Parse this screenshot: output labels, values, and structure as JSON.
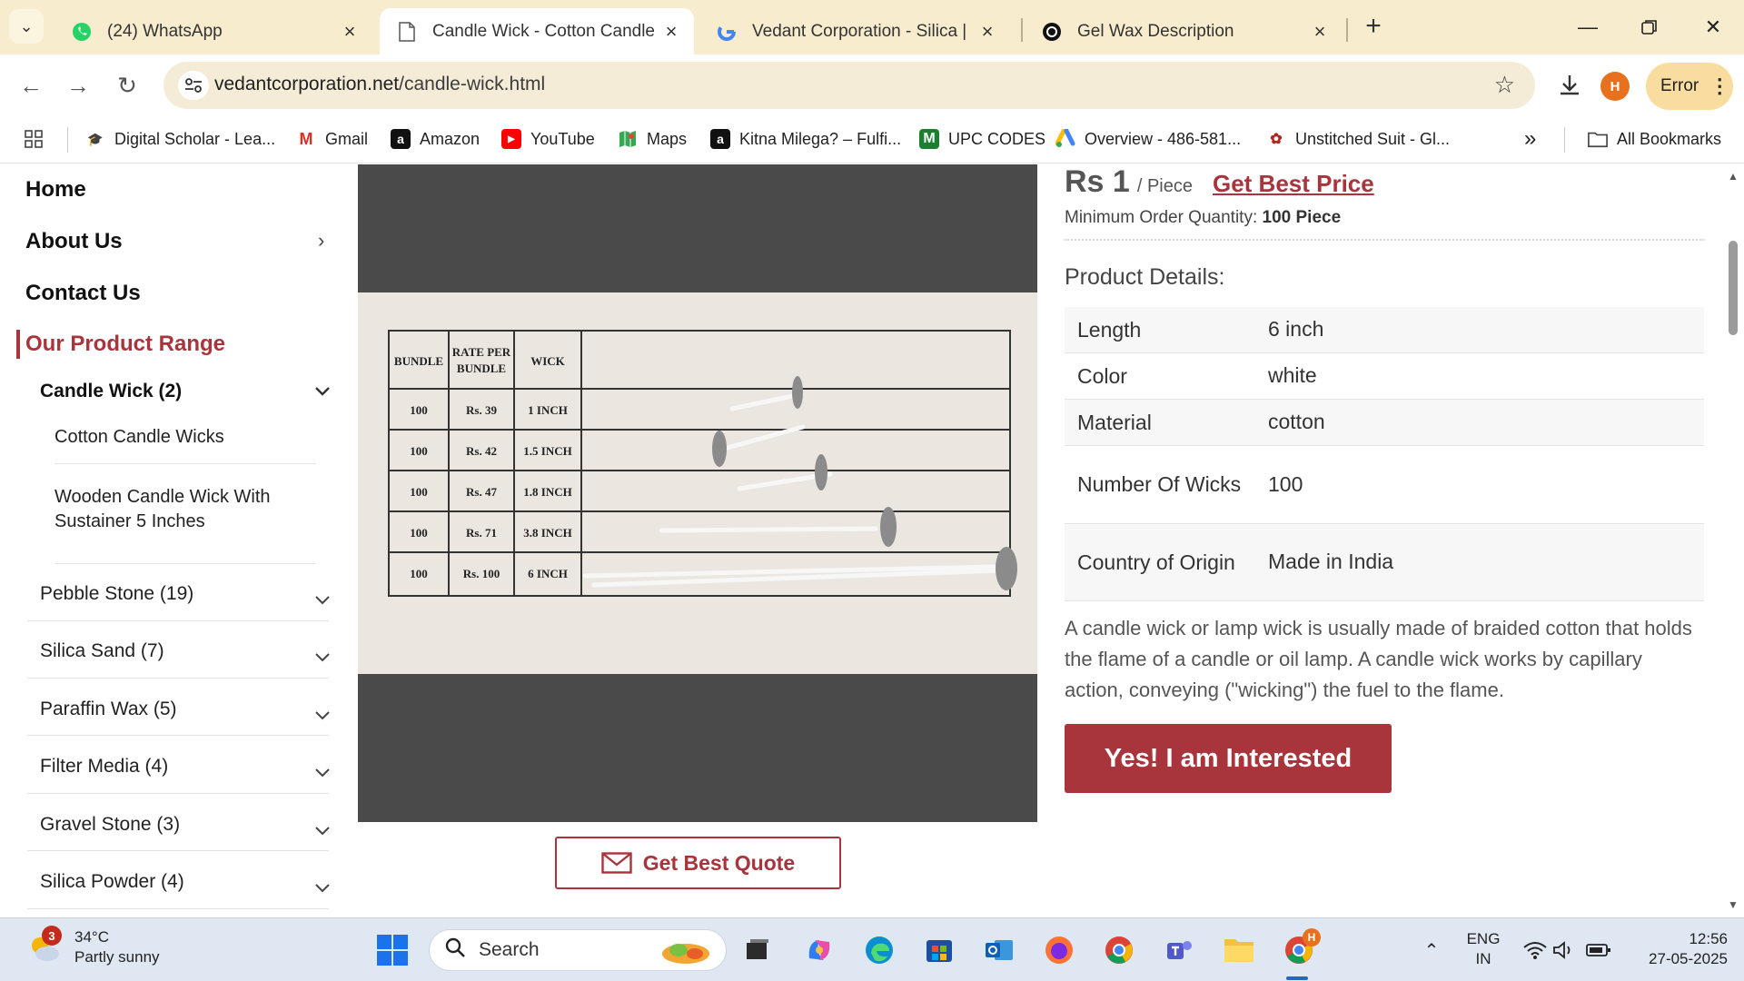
{
  "browser": {
    "tabs": [
      {
        "title": "(24) WhatsApp",
        "icon": "whatsapp-icon",
        "active": false
      },
      {
        "title": "Candle Wick - Cotton Candle W",
        "icon": "page-icon",
        "active": true
      },
      {
        "title": "Vedant Corporation - Silica | Qu",
        "icon": "google-icon",
        "active": false
      },
      {
        "title": "Gel Wax Description",
        "icon": "chatgpt-icon",
        "active": false
      }
    ],
    "url_host": "vedantcorporation.net",
    "url_path": "/candle-wick.html",
    "profile_initial": "H",
    "error_label": "Error",
    "bookmarks": [
      {
        "label": "Digital Scholar - Lea..."
      },
      {
        "label": "Gmail"
      },
      {
        "label": "Amazon"
      },
      {
        "label": "YouTube"
      },
      {
        "label": "Maps"
      },
      {
        "label": "Kitna Milega? – Fulfi..."
      },
      {
        "label": "UPC CODES"
      },
      {
        "label": "Overview - 486-581..."
      },
      {
        "label": "Unstitched Suit - Gl..."
      }
    ],
    "more_bookmarks": "»",
    "all_bookmarks": "All Bookmarks"
  },
  "sidebar": {
    "home": "Home",
    "about": "About Us",
    "contact": "Contact Us",
    "range_title": "Our Product Range",
    "active_category": "Candle Wick (2)",
    "sub_items": [
      "Cotton Candle Wicks",
      "Wooden Candle Wick With Sustainer 5 Inches"
    ],
    "categories": [
      "Pebble Stone (19)",
      "Silica Sand (7)",
      "Paraffin Wax (5)",
      "Filter Media (4)",
      "Gravel Stone (3)",
      "Silica Powder (4)"
    ]
  },
  "product": {
    "price": "Rs 1",
    "price_unit": "/ Piece",
    "best_price_label": "Get Best Price",
    "moq_label": "Minimum Order Quantity:",
    "moq_value": "100 Piece",
    "details_title": "Product Details:",
    "specs": [
      {
        "key": "Length",
        "value": "6 inch"
      },
      {
        "key": "Color",
        "value": "white"
      },
      {
        "key": "Material",
        "value": "cotton"
      },
      {
        "key": "Number Of Wicks",
        "value": "100"
      },
      {
        "key": "Country of Origin",
        "value": "Made in India"
      }
    ],
    "description": "A candle wick or lamp wick is usually made of braided cotton that holds the flame of a candle or oil lamp. A candle wick works by capillary action, conveying (\"wicking\") the fuel to the flame.",
    "interest_button": "Yes! I am Interested",
    "quote_button": "Get Best Quote",
    "photo_table": {
      "headers": [
        "BUNDLE",
        "RATE PER BUNDLE",
        "WICK"
      ],
      "rows": [
        [
          "100",
          "Rs. 39",
          "1 INCH"
        ],
        [
          "100",
          "Rs. 42",
          "1.5 INCH"
        ],
        [
          "100",
          "Rs. 47",
          "1.8 INCH"
        ],
        [
          "100",
          "Rs. 71",
          "3.8 INCH"
        ],
        [
          "100",
          "Rs. 100",
          "6 INCH"
        ]
      ]
    }
  },
  "taskbar": {
    "weather_badge": "3",
    "temperature": "34°C",
    "weather_text": "Partly sunny",
    "search_label": "Search",
    "lang_line1": "ENG",
    "lang_line2": "IN",
    "time": "12:56",
    "date": "27-05-2025",
    "chrome_badge": "H"
  },
  "colors": {
    "brand": "#a8343c",
    "tabstrip": "#f7eccd",
    "taskbar": "#dfe7f2"
  }
}
